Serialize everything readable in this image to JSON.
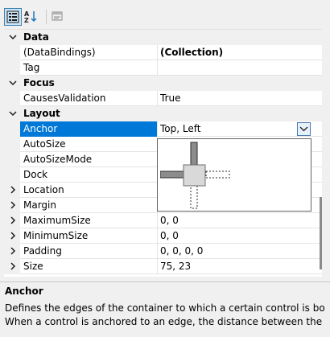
{
  "toolbar": {
    "buttons": [
      {
        "name": "categorized-icon",
        "active": true
      },
      {
        "name": "alphabetical-icon",
        "active": false
      },
      {
        "name": "property-pages-icon",
        "active": false
      }
    ]
  },
  "grid": {
    "categories": {
      "data": "Data",
      "focus": "Focus",
      "layout": "Layout"
    },
    "properties": {
      "databindings": {
        "name": "(DataBindings)",
        "value": "(Collection)"
      },
      "tag": {
        "name": "Tag",
        "value": ""
      },
      "causesvalidation": {
        "name": "CausesValidation",
        "value": "True"
      },
      "anchor": {
        "name": "Anchor",
        "value": "Top, Left"
      },
      "autosize": {
        "name": "AutoSize",
        "value": ""
      },
      "autosizemode": {
        "name": "AutoSizeMode",
        "value": ""
      },
      "dock": {
        "name": "Dock",
        "value": ""
      },
      "location": {
        "name": "Location",
        "value": ""
      },
      "margin": {
        "name": "Margin",
        "value": ""
      },
      "maximumsize": {
        "name": "MaximumSize",
        "value": "0, 0"
      },
      "minimumsize": {
        "name": "MinimumSize",
        "value": "0, 0"
      },
      "padding": {
        "name": "Padding",
        "value": "0, 0, 0, 0"
      },
      "size": {
        "name": "Size",
        "value": "75, 23"
      }
    }
  },
  "anchor_editor": {
    "top": true,
    "left": true,
    "right": false,
    "bottom": false
  },
  "help": {
    "title": "Anchor",
    "line1": "Defines the edges of the container to which a certain control is bound.",
    "line2": "When a control is anchored to an edge, the distance between the contr..."
  },
  "colors": {
    "selection": "#0078d7",
    "category_bg": "#f0f0f0"
  }
}
